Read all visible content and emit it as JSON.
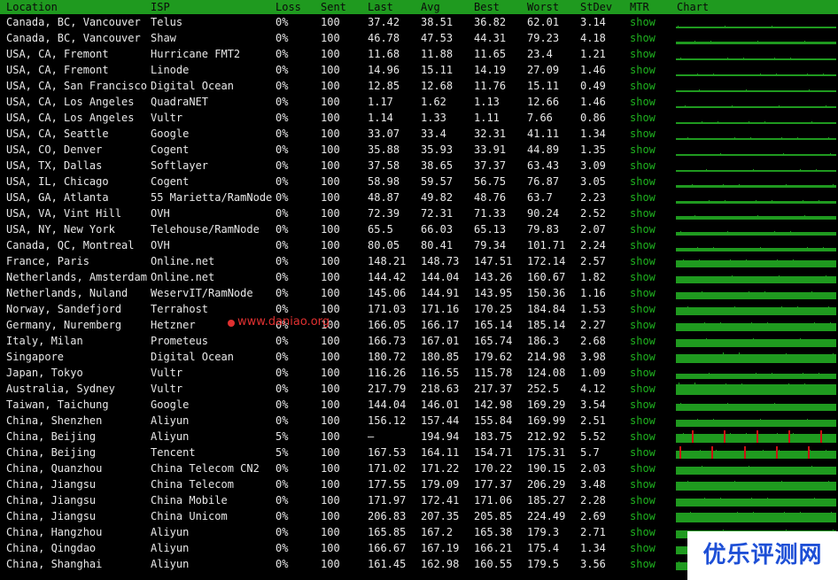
{
  "header": {
    "location": "Location",
    "isp": "ISP",
    "loss": "Loss",
    "sent": "Sent",
    "last": "Last",
    "avg": "Avg",
    "best": "Best",
    "worst": "Worst",
    "stdev": "StDev",
    "mtr": "MTR",
    "chart": "Chart"
  },
  "colors": {
    "header_bg": "#1f9a1f",
    "mtr_link": "#1fb31f",
    "chart_bar": "#1f9a1f",
    "chart_loss": "#cc1111",
    "watermark": "#e03030",
    "logo_text": "#1d4fd6"
  },
  "rows": [
    {
      "location": "Canada, BC, Vancouver",
      "isp": "Telus",
      "loss": "0%",
      "sent": "100",
      "last": "37.42",
      "avg": "38.51",
      "best": "36.82",
      "worst": "62.01",
      "stdev": "3.14",
      "mtr": "show"
    },
    {
      "location": "Canada, BC, Vancouver",
      "isp": "Shaw",
      "loss": "0%",
      "sent": "100",
      "last": "46.78",
      "avg": "47.53",
      "best": "44.31",
      "worst": "79.23",
      "stdev": "4.18",
      "mtr": "show"
    },
    {
      "location": "USA, CA, Fremont",
      "isp": "Hurricane FMT2",
      "loss": "0%",
      "sent": "100",
      "last": "11.68",
      "avg": "11.88",
      "best": "11.65",
      "worst": "23.4",
      "stdev": "1.21",
      "mtr": "show"
    },
    {
      "location": "USA, CA, Fremont",
      "isp": "Linode",
      "loss": "0%",
      "sent": "100",
      "last": "14.96",
      "avg": "15.11",
      "best": "14.19",
      "worst": "27.09",
      "stdev": "1.46",
      "mtr": "show"
    },
    {
      "location": "USA, CA, San Francisco",
      "isp": "Digital Ocean",
      "loss": "0%",
      "sent": "100",
      "last": "12.85",
      "avg": "12.68",
      "best": "11.76",
      "worst": "15.11",
      "stdev": "0.49",
      "mtr": "show"
    },
    {
      "location": "USA, CA, Los Angeles",
      "isp": "QuadraNET",
      "loss": "0%",
      "sent": "100",
      "last": "1.17",
      "avg": "1.62",
      "best": "1.13",
      "worst": "12.66",
      "stdev": "1.46",
      "mtr": "show"
    },
    {
      "location": "USA, CA, Los Angeles",
      "isp": "Vultr",
      "loss": "0%",
      "sent": "100",
      "last": "1.14",
      "avg": "1.33",
      "best": "1.11",
      "worst": "7.66",
      "stdev": "0.86",
      "mtr": "show"
    },
    {
      "location": "USA, CA, Seattle",
      "isp": "Google",
      "loss": "0%",
      "sent": "100",
      "last": "33.07",
      "avg": "33.4",
      "best": "32.31",
      "worst": "41.11",
      "stdev": "1.34",
      "mtr": "show"
    },
    {
      "location": "USA, CO, Denver",
      "isp": "Cogent",
      "loss": "0%",
      "sent": "100",
      "last": "35.88",
      "avg": "35.93",
      "best": "33.91",
      "worst": "44.89",
      "stdev": "1.35",
      "mtr": "show"
    },
    {
      "location": "USA, TX, Dallas",
      "isp": "Softlayer",
      "loss": "0%",
      "sent": "100",
      "last": "37.58",
      "avg": "38.65",
      "best": "37.37",
      "worst": "63.43",
      "stdev": "3.09",
      "mtr": "show"
    },
    {
      "location": "USA, IL, Chicago",
      "isp": "Cogent",
      "loss": "0%",
      "sent": "100",
      "last": "58.98",
      "avg": "59.57",
      "best": "56.75",
      "worst": "76.87",
      "stdev": "3.05",
      "mtr": "show"
    },
    {
      "location": "USA, GA, Atlanta",
      "isp": "55 Marietta/RamNode",
      "loss": "0%",
      "sent": "100",
      "last": "48.87",
      "avg": "49.82",
      "best": "48.76",
      "worst": "63.7",
      "stdev": "2.23",
      "mtr": "show"
    },
    {
      "location": "USA, VA, Vint Hill",
      "isp": "OVH",
      "loss": "0%",
      "sent": "100",
      "last": "72.39",
      "avg": "72.31",
      "best": "71.33",
      "worst": "90.24",
      "stdev": "2.52",
      "mtr": "show"
    },
    {
      "location": "USA, NY, New York",
      "isp": "Telehouse/RamNode",
      "loss": "0%",
      "sent": "100",
      "last": "65.5",
      "avg": "66.03",
      "best": "65.13",
      "worst": "79.83",
      "stdev": "2.07",
      "mtr": "show"
    },
    {
      "location": "Canada, QC, Montreal",
      "isp": "OVH",
      "loss": "0%",
      "sent": "100",
      "last": "80.05",
      "avg": "80.41",
      "best": "79.34",
      "worst": "101.71",
      "stdev": "2.24",
      "mtr": "show"
    },
    {
      "location": "France, Paris",
      "isp": "Online.net",
      "loss": "0%",
      "sent": "100",
      "last": "148.21",
      "avg": "148.73",
      "best": "147.51",
      "worst": "172.14",
      "stdev": "2.57",
      "mtr": "show"
    },
    {
      "location": "Netherlands, Amsterdam",
      "isp": "Online.net",
      "loss": "0%",
      "sent": "100",
      "last": "144.42",
      "avg": "144.04",
      "best": "143.26",
      "worst": "160.67",
      "stdev": "1.82",
      "mtr": "show"
    },
    {
      "location": "Netherlands, Nuland",
      "isp": "WeservIT/RamNode",
      "loss": "0%",
      "sent": "100",
      "last": "145.06",
      "avg": "144.91",
      "best": "143.95",
      "worst": "150.36",
      "stdev": "1.16",
      "mtr": "show"
    },
    {
      "location": "Norway, Sandefjord",
      "isp": "Terrahost",
      "loss": "0%",
      "sent": "100",
      "last": "171.03",
      "avg": "171.16",
      "best": "170.25",
      "worst": "184.84",
      "stdev": "1.53",
      "mtr": "show"
    },
    {
      "location": "Germany, Nuremberg",
      "isp": "Hetzner",
      "loss": "0%",
      "sent": "100",
      "last": "166.05",
      "avg": "166.17",
      "best": "165.14",
      "worst": "185.14",
      "stdev": "2.27",
      "mtr": "show"
    },
    {
      "location": "Italy, Milan",
      "isp": "Prometeus",
      "loss": "0%",
      "sent": "100",
      "last": "166.73",
      "avg": "167.01",
      "best": "165.74",
      "worst": "186.3",
      "stdev": "2.68",
      "mtr": "show"
    },
    {
      "location": "Singapore",
      "isp": "Digital Ocean",
      "loss": "0%",
      "sent": "100",
      "last": "180.72",
      "avg": "180.85",
      "best": "179.62",
      "worst": "214.98",
      "stdev": "3.98",
      "mtr": "show"
    },
    {
      "location": "Japan, Tokyo",
      "isp": "Vultr",
      "loss": "0%",
      "sent": "100",
      "last": "116.26",
      "avg": "116.55",
      "best": "115.78",
      "worst": "124.08",
      "stdev": "1.09",
      "mtr": "show"
    },
    {
      "location": "Australia, Sydney",
      "isp": "Vultr",
      "loss": "0%",
      "sent": "100",
      "last": "217.79",
      "avg": "218.63",
      "best": "217.37",
      "worst": "252.5",
      "stdev": "4.12",
      "mtr": "show"
    },
    {
      "location": "Taiwan, Taichung",
      "isp": "Google",
      "loss": "0%",
      "sent": "100",
      "last": "144.04",
      "avg": "146.01",
      "best": "142.98",
      "worst": "169.29",
      "stdev": "3.54",
      "mtr": "show"
    },
    {
      "location": "China, Shenzhen",
      "isp": "Aliyun",
      "loss": "0%",
      "sent": "100",
      "last": "156.12",
      "avg": "157.44",
      "best": "155.84",
      "worst": "169.99",
      "stdev": "2.51",
      "mtr": "show"
    },
    {
      "location": "China, Beijing",
      "isp": "Aliyun",
      "loss": "5%",
      "sent": "100",
      "last": "–",
      "avg": "194.94",
      "best": "183.75",
      "worst": "212.92",
      "stdev": "5.52",
      "mtr": "show"
    },
    {
      "location": "China, Beijing",
      "isp": "Tencent",
      "loss": "5%",
      "sent": "100",
      "last": "167.53",
      "avg": "164.11",
      "best": "154.71",
      "worst": "175.31",
      "stdev": "5.7",
      "mtr": "show"
    },
    {
      "location": "China, Quanzhou",
      "isp": "China Telecom CN2",
      "loss": "0%",
      "sent": "100",
      "last": "171.02",
      "avg": "171.22",
      "best": "170.22",
      "worst": "190.15",
      "stdev": "2.03",
      "mtr": "show"
    },
    {
      "location": "China, Jiangsu",
      "isp": "China Telecom",
      "loss": "0%",
      "sent": "100",
      "last": "177.55",
      "avg": "179.09",
      "best": "177.37",
      "worst": "206.29",
      "stdev": "3.48",
      "mtr": "show"
    },
    {
      "location": "China, Jiangsu",
      "isp": "China Mobile",
      "loss": "0%",
      "sent": "100",
      "last": "171.97",
      "avg": "172.41",
      "best": "171.06",
      "worst": "185.27",
      "stdev": "2.28",
      "mtr": "show"
    },
    {
      "location": "China, Jiangsu",
      "isp": "China Unicom",
      "loss": "0%",
      "sent": "100",
      "last": "206.83",
      "avg": "207.35",
      "best": "205.85",
      "worst": "224.49",
      "stdev": "2.69",
      "mtr": "show"
    },
    {
      "location": "China, Hangzhou",
      "isp": "Aliyun",
      "loss": "0%",
      "sent": "100",
      "last": "165.85",
      "avg": "167.2",
      "best": "165.38",
      "worst": "179.3",
      "stdev": "2.71",
      "mtr": "show"
    },
    {
      "location": "China, Qingdao",
      "isp": "Aliyun",
      "loss": "0%",
      "sent": "100",
      "last": "166.67",
      "avg": "167.19",
      "best": "166.21",
      "worst": "175.4",
      "stdev": "1.34",
      "mtr": "show"
    },
    {
      "location": "China, Shanghai",
      "isp": "Aliyun",
      "loss": "0%",
      "sent": "100",
      "last": "161.45",
      "avg": "162.98",
      "best": "160.55",
      "worst": "179.5",
      "stdev": "3.56",
      "mtr": "show"
    }
  ],
  "watermark": "www.daniao.org",
  "logo": "优乐评测网"
}
